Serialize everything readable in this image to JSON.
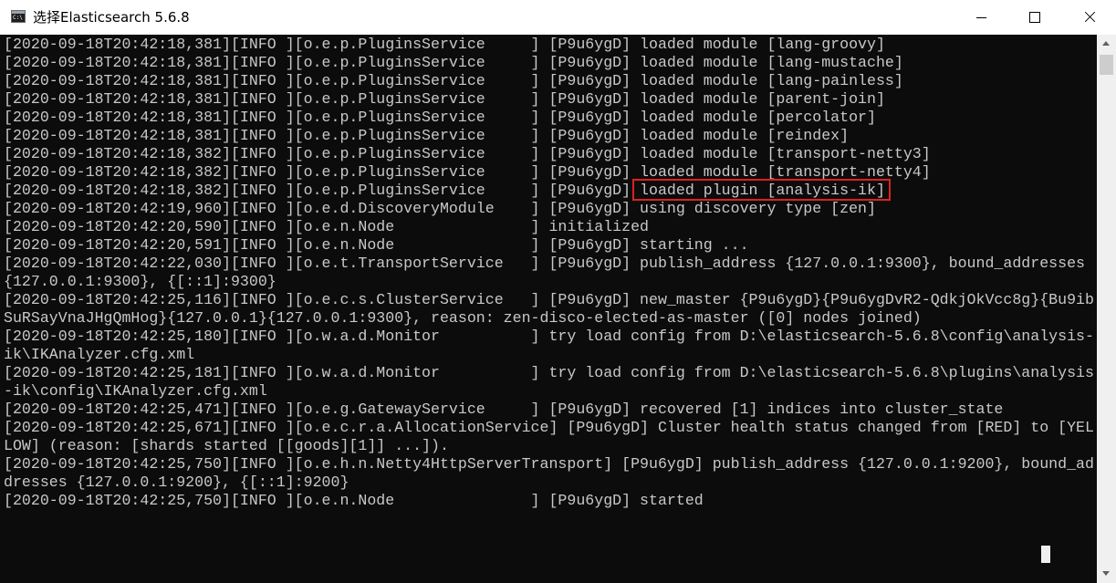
{
  "window": {
    "title": "选择Elasticsearch 5.6.8",
    "icon": "console-app-icon"
  },
  "titlebar_buttons": {
    "minimize": "minimize-icon",
    "maximize": "maximize-icon",
    "close": "close-icon"
  },
  "console": {
    "lines": [
      "[2020-09-18T20:42:18,381][INFO ][o.e.p.PluginsService     ] [P9u6ygD] loaded module [lang-groovy]",
      "[2020-09-18T20:42:18,381][INFO ][o.e.p.PluginsService     ] [P9u6ygD] loaded module [lang-mustache]",
      "[2020-09-18T20:42:18,381][INFO ][o.e.p.PluginsService     ] [P9u6ygD] loaded module [lang-painless]",
      "[2020-09-18T20:42:18,381][INFO ][o.e.p.PluginsService     ] [P9u6ygD] loaded module [parent-join]",
      "[2020-09-18T20:42:18,381][INFO ][o.e.p.PluginsService     ] [P9u6ygD] loaded module [percolator]",
      "[2020-09-18T20:42:18,381][INFO ][o.e.p.PluginsService     ] [P9u6ygD] loaded module [reindex]",
      "[2020-09-18T20:42:18,382][INFO ][o.e.p.PluginsService     ] [P9u6ygD] loaded module [transport-netty3]",
      "[2020-09-18T20:42:18,382][INFO ][o.e.p.PluginsService     ] [P9u6ygD] loaded module [transport-netty4]",
      "[2020-09-18T20:42:18,382][INFO ][o.e.p.PluginsService     ] [P9u6ygD] loaded plugin [analysis-ik]",
      "[2020-09-18T20:42:19,960][INFO ][o.e.d.DiscoveryModule    ] [P9u6ygD] using discovery type [zen]",
      "[2020-09-18T20:42:20,590][INFO ][o.e.n.Node               ] initialized",
      "[2020-09-18T20:42:20,591][INFO ][o.e.n.Node               ] [P9u6ygD] starting ...",
      "[2020-09-18T20:42:22,030][INFO ][o.e.t.TransportService   ] [P9u6ygD] publish_address {127.0.0.1:9300}, bound_addresses",
      "{127.0.0.1:9300}, {[::1]:9300}",
      "[2020-09-18T20:42:25,116][INFO ][o.e.c.s.ClusterService   ] [P9u6ygD] new_master {P9u6ygD}{P9u6ygDvR2-QdkjOkVcc8g}{Bu9ib",
      "SuRSayVnaJHgQmHog}{127.0.0.1}{127.0.0.1:9300}, reason: zen-disco-elected-as-master ([0] nodes joined)",
      "[2020-09-18T20:42:25,180][INFO ][o.w.a.d.Monitor          ] try load config from D:\\elasticsearch-5.6.8\\config\\analysis-",
      "ik\\IKAnalyzer.cfg.xml",
      "[2020-09-18T20:42:25,181][INFO ][o.w.a.d.Monitor          ] try load config from D:\\elasticsearch-5.6.8\\plugins\\analysis",
      "-ik\\config\\IKAnalyzer.cfg.xml",
      "[2020-09-18T20:42:25,471][INFO ][o.e.g.GatewayService     ] [P9u6ygD] recovered [1] indices into cluster_state",
      "[2020-09-18T20:42:25,671][INFO ][o.e.c.r.a.AllocationService] [P9u6ygD] Cluster health status changed from [RED] to [YEL",
      "LOW] (reason: [shards started [[goods][1]] ...]).",
      "[2020-09-18T20:42:25,750][INFO ][o.e.h.n.Netty4HttpServerTransport] [P9u6ygD] publish_address {127.0.0.1:9200}, bound_ad",
      "dresses {127.0.0.1:9200}, {[::1]:9200}",
      "[2020-09-18T20:42:25,750][INFO ][o.e.n.Node               ] [P9u6ygD] started"
    ],
    "highlighted_text": "loaded plugin [analysis-ik]",
    "highlight_color": "#e02020",
    "text_color": "#c8c8c8",
    "background_color": "#0c0c0c"
  },
  "scrollbar": {
    "up_icon": "scroll-up-arrow-icon",
    "down_icon": "scroll-down-arrow-icon"
  }
}
